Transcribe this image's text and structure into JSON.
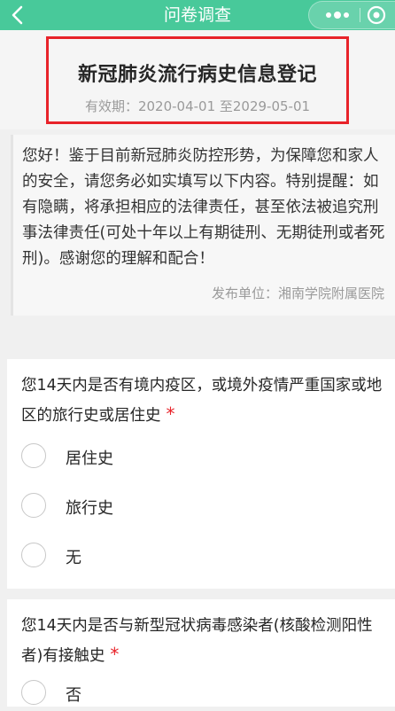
{
  "header": {
    "title": "问卷调查",
    "background_color": "#48c99a",
    "back_icon": "chevron-left-icon",
    "more_icon": "more-dots-icon",
    "close_icon": "target-circle-icon"
  },
  "survey": {
    "title": "新冠肺炎流行病史信息登记",
    "validity": "有效期：2020-04-01 至2029-05-01",
    "highlight_color": "#e8232a"
  },
  "intro": {
    "text": "您好！鉴于目前新冠肺炎防控形势，为保障您和家人的安全，请您务必如实填写以下内容。特别提醒：如有隐瞒，将承担相应的法律责任，甚至依法被追究刑事法律责任(可处十年以上有期徒刑、无期徒刑或者死刑)。感谢您的理解和配合！",
    "publisher": "发布单位：湘南学院附属医院"
  },
  "questions": [
    {
      "text": "您14天内是否有境内疫区，或境外疫情严重国家或地区的旅行史或居住史",
      "required_mark": "*",
      "options": [
        "居住史",
        "旅行史",
        "无"
      ]
    },
    {
      "text": "您14天内是否与新型冠状病毒感染者(核酸检测阳性者)有接触史",
      "required_mark": "*",
      "options": [
        "否"
      ]
    }
  ]
}
